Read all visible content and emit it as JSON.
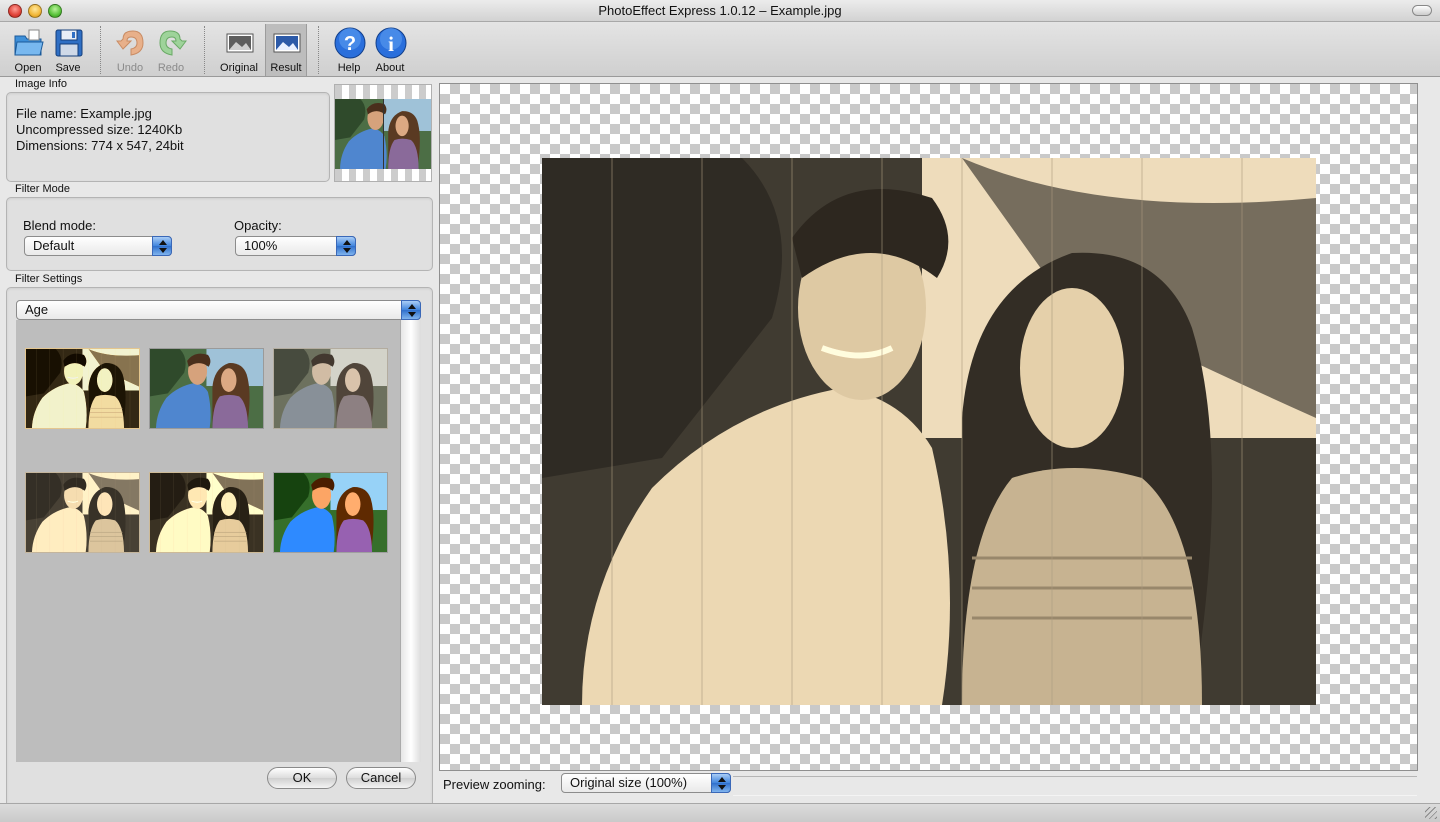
{
  "window": {
    "title": "PhotoEffect Express 1.0.12 – Example.jpg"
  },
  "toolbar": {
    "open": "Open",
    "save": "Save",
    "undo": "Undo",
    "redo": "Redo",
    "original": "Original",
    "result": "Result",
    "help": "Help",
    "about": "About"
  },
  "image_info": {
    "title": "Image Info",
    "file_name": "File name: Example.jpg",
    "uncompressed": "Uncompressed size: 1240Kb",
    "dimensions": "Dimensions: 774 x 547, 24bit"
  },
  "filter_mode": {
    "title": "Filter Mode",
    "blend_label": "Blend mode:",
    "blend_value": "Default",
    "opacity_label": "Opacity:",
    "opacity_value": "100%"
  },
  "filter_settings": {
    "title": "Filter Settings",
    "filter_value": "Age",
    "presets": [
      "age-grain-preset",
      "original-color-preset",
      "faded-color-preset",
      "sepia-light-preset",
      "sepia-grain-preset",
      "color-noise-preset"
    ]
  },
  "dialog": {
    "ok": "OK",
    "cancel": "Cancel"
  },
  "preview": {
    "zoom_label": "Preview zooming:",
    "zoom_value": "Original size (100%)"
  },
  "colors": {
    "accent": "#3f84dd",
    "sepia_light": "#e6d6bc",
    "sepia_dark": "#2e2a24"
  }
}
